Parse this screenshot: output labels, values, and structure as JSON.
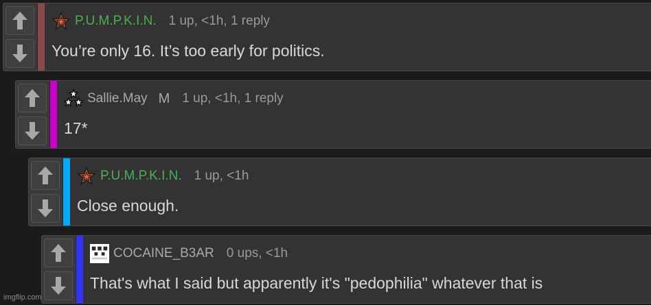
{
  "comments": [
    {
      "username": "P.U.M.P.K.I.N.",
      "badge": "",
      "meta": "1 up, <1h, 1 reply",
      "text": "You’re only 16. It’s too early for politics.",
      "avatar_icon": "orange-star-icon",
      "bar_color": "#8b4a4a"
    },
    {
      "username": "Sallie.May",
      "badge": "M",
      "meta": "1 up, <1h, 1 reply",
      "text": "17*",
      "avatar_icon": "three-stars-icon",
      "bar_color": "#cc00cc"
    },
    {
      "username": "P.U.M.P.K.I.N.",
      "badge": "",
      "meta": "1 up, <1h",
      "text": "Close enough.",
      "avatar_icon": "orange-star-icon",
      "bar_color": "#00aaff"
    },
    {
      "username": "COCAINE_B3AR",
      "badge": "",
      "meta": "0 ups, <1h",
      "text": "That's what I said but apparently it's \"pedophilia\" whatever that is",
      "avatar_icon": "pixel-face-icon",
      "bar_color": "#3333ff"
    }
  ],
  "watermark": "imgflip.com"
}
